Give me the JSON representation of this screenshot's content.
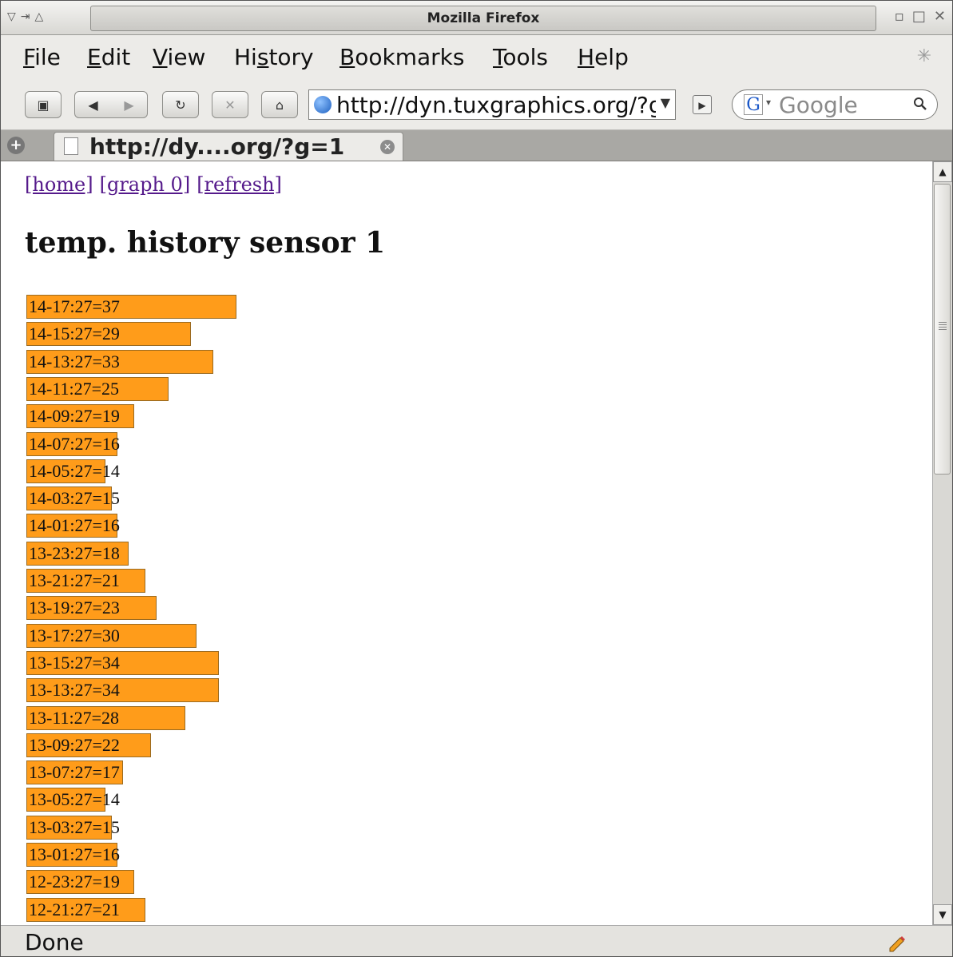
{
  "window": {
    "title": "Mozilla Firefox"
  },
  "menu": {
    "items": [
      {
        "label": "File",
        "accel": "F",
        "rest": "ile"
      },
      {
        "label": "Edit",
        "accel": "E",
        "rest": "dit"
      },
      {
        "label": "View",
        "accel": "V",
        "rest": "iew"
      },
      {
        "label": "History",
        "pre": "Hi",
        "accel": "s",
        "rest": "tory"
      },
      {
        "label": "Bookmarks",
        "accel": "B",
        "rest": "ookmarks"
      },
      {
        "label": "Tools",
        "accel": "T",
        "rest": "ools"
      },
      {
        "label": "Help",
        "accel": "H",
        "rest": "elp"
      }
    ]
  },
  "toolbar": {
    "url": "http://dyn.tuxgraphics.org/?g=1",
    "search_placeholder": "Google"
  },
  "tab": {
    "title": "http://dy....org/?g=1"
  },
  "page": {
    "links": [
      "[home]",
      "[graph 0]",
      "[refresh]"
    ],
    "heading": "temp. history sensor 1"
  },
  "chart_data": {
    "type": "bar",
    "orientation": "horizontal",
    "title": "temp. history sensor 1",
    "bar_color": "#ff9c1a",
    "categories": [
      "14-17:27",
      "14-15:27",
      "14-13:27",
      "14-11:27",
      "14-09:27",
      "14-07:27",
      "14-05:27",
      "14-03:27",
      "14-01:27",
      "13-23:27",
      "13-21:27",
      "13-19:27",
      "13-17:27",
      "13-15:27",
      "13-13:27",
      "13-11:27",
      "13-09:27",
      "13-07:27",
      "13-05:27",
      "13-03:27",
      "13-01:27",
      "12-23:27",
      "12-21:27"
    ],
    "values": [
      37,
      29,
      33,
      25,
      19,
      16,
      14,
      15,
      16,
      18,
      21,
      23,
      30,
      34,
      34,
      28,
      22,
      17,
      14,
      15,
      16,
      19,
      21
    ],
    "labels": [
      "14-17:27=37",
      "14-15:27=29",
      "14-13:27=33",
      "14-11:27=25",
      "14-09:27=19",
      "14-07:27=16",
      "14-05:27=14",
      "14-03:27=15",
      "14-01:27=16",
      "13-23:27=18",
      "13-21:27=21",
      "13-19:27=23",
      "13-17:27=30",
      "13-15:27=34",
      "13-13:27=34",
      "13-11:27=28",
      "13-09:27=22",
      "13-07:27=17",
      "13-05:27=14",
      "13-03:27=15",
      "13-01:27=16",
      "12-23:27=19",
      "12-21:27=21"
    ]
  },
  "status": {
    "text": "Done"
  }
}
